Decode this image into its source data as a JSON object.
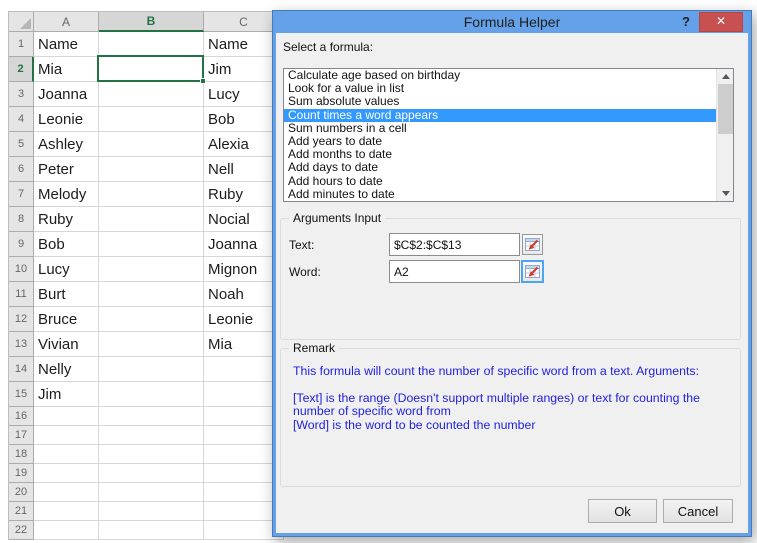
{
  "colors": {
    "excel_green": "#217346",
    "titlebar_blue": "#64A1E8",
    "close_red": "#C75050",
    "list_selection_blue": "#3399FF",
    "remark_text_blue": "#2121DE",
    "dialog_bg": "#F0F0F0"
  },
  "spreadsheet": {
    "columns": [
      "A",
      "B",
      "C"
    ],
    "selected_column": "B",
    "selected_row": 2,
    "selected_cell": "B2",
    "rows": [
      {
        "n": 1,
        "a": "Name",
        "b": "",
        "c": "Name"
      },
      {
        "n": 2,
        "a": "Mia",
        "b": "",
        "c": "Jim"
      },
      {
        "n": 3,
        "a": "Joanna",
        "b": "",
        "c": "Lucy"
      },
      {
        "n": 4,
        "a": "Leonie",
        "b": "",
        "c": "Bob"
      },
      {
        "n": 5,
        "a": "Ashley",
        "b": "",
        "c": "Alexia"
      },
      {
        "n": 6,
        "a": "Peter",
        "b": "",
        "c": "Nell"
      },
      {
        "n": 7,
        "a": "Melody",
        "b": "",
        "c": "Ruby"
      },
      {
        "n": 8,
        "a": "Ruby",
        "b": "",
        "c": "Nocial"
      },
      {
        "n": 9,
        "a": "Bob",
        "b": "",
        "c": "Joanna"
      },
      {
        "n": 10,
        "a": "Lucy",
        "b": "",
        "c": "Mignon"
      },
      {
        "n": 11,
        "a": "Burt",
        "b": "",
        "c": "Noah"
      },
      {
        "n": 12,
        "a": "Bruce",
        "b": "",
        "c": "Leonie"
      },
      {
        "n": 13,
        "a": "Vivian",
        "b": "",
        "c": "Mia"
      },
      {
        "n": 14,
        "a": "Nelly",
        "b": "",
        "c": ""
      },
      {
        "n": 15,
        "a": "Jim",
        "b": "",
        "c": ""
      },
      {
        "n": 16,
        "a": "",
        "b": "",
        "c": ""
      },
      {
        "n": 17,
        "a": "",
        "b": "",
        "c": ""
      },
      {
        "n": 18,
        "a": "",
        "b": "",
        "c": ""
      },
      {
        "n": 19,
        "a": "",
        "b": "",
        "c": ""
      },
      {
        "n": 20,
        "a": "",
        "b": "",
        "c": ""
      },
      {
        "n": 21,
        "a": "",
        "b": "",
        "c": ""
      },
      {
        "n": 22,
        "a": "",
        "b": "",
        "c": ""
      }
    ]
  },
  "dialog": {
    "title": "Formula Helper",
    "help_glyph": "?",
    "close_glyph": "✕",
    "select_label": "Select a formula:",
    "formula_list": {
      "selected_index": 3,
      "items": [
        "Calculate age based on birthday",
        "Look for a value in list",
        "Sum absolute values",
        "Count times a word appears",
        "Sum numbers in a cell",
        "Add years to date",
        "Add months to date",
        "Add days to date",
        "Add hours to date",
        "Add minutes to date"
      ]
    },
    "arguments": {
      "group_label": "Arguments Input",
      "fields": [
        {
          "label": "Text:",
          "value": "$C$2:$C$13",
          "focused": false
        },
        {
          "label": "Word:",
          "value": "A2",
          "focused": true
        }
      ]
    },
    "remark": {
      "group_label": "Remark",
      "lines": [
        "This formula will count the number of specific word from a text. Arguments:",
        "[Text] is the range (Doesn't support multiple ranges) or text for counting the number of specific word from",
        "[Word] is the word to be counted the number"
      ]
    },
    "buttons": {
      "ok": "Ok",
      "cancel": "Cancel"
    }
  }
}
